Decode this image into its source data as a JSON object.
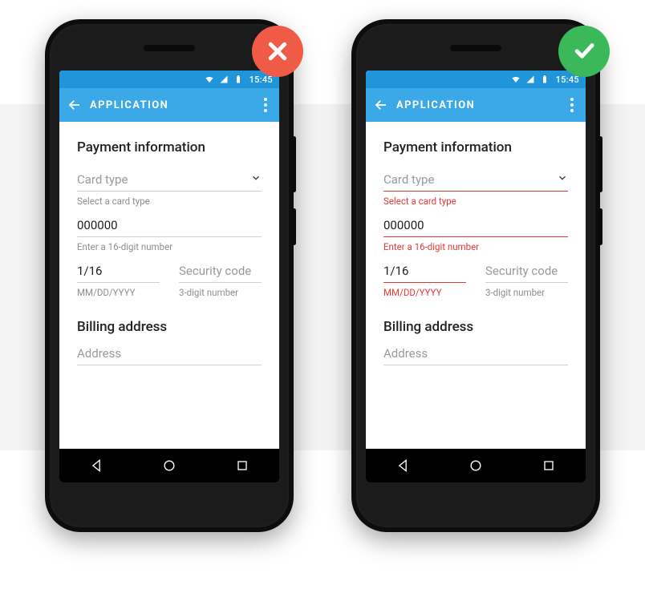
{
  "colors": {
    "statusbar": "#2095da",
    "appbar": "#3ba9e8",
    "error": "#e53935",
    "badge_bad": "#f05b47",
    "badge_good": "#3bb859"
  },
  "statusbar": {
    "time": "15:45"
  },
  "appbar": {
    "title": "APPLICATION"
  },
  "left": {
    "sections": {
      "payment_title": "Payment information",
      "billing_title": "Billing address"
    },
    "fields": {
      "card_type": {
        "label": "Card type",
        "helper": "Select a card type",
        "error": false,
        "placeholder": true
      },
      "card_number": {
        "value": "000000",
        "helper": "Enter a 16-digit number",
        "error": false
      },
      "expiry": {
        "value": "1/16",
        "helper": "MM/DD/YYYY",
        "error": false
      },
      "security": {
        "label": "Security code",
        "helper": "3-digit number",
        "error": false,
        "placeholder": true
      },
      "address": {
        "label": "Address",
        "placeholder": true
      }
    }
  },
  "right": {
    "sections": {
      "payment_title": "Payment information",
      "billing_title": "Billing address"
    },
    "fields": {
      "card_type": {
        "label": "Card type",
        "helper": "Select a card type",
        "error": true,
        "placeholder": true
      },
      "card_number": {
        "value": "000000",
        "helper": "Enter a 16-digit number",
        "error": true
      },
      "expiry": {
        "value": "1/16",
        "helper": "MM/DD/YYYY",
        "error": true
      },
      "security": {
        "label": "Security code",
        "helper": "3-digit number",
        "error": false,
        "placeholder": true
      },
      "address": {
        "label": "Address",
        "placeholder": true
      }
    }
  }
}
